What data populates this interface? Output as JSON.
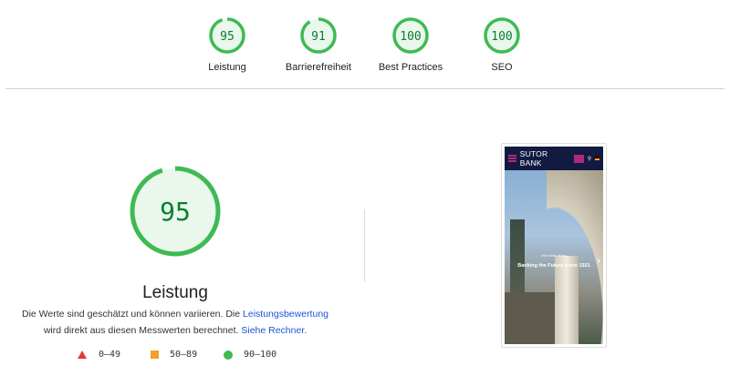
{
  "categories": [
    {
      "label": "Leistung",
      "score": 95
    },
    {
      "label": "Barrierefreiheit",
      "score": 91
    },
    {
      "label": "Best Practices",
      "score": 100
    },
    {
      "label": "SEO",
      "score": 100
    }
  ],
  "main": {
    "score": 95,
    "title": "Leistung",
    "desc_prefix": "Die Werte sind geschätzt und können variieren. Die ",
    "link1": "Leistungsbewertung",
    "desc_mid": " wird direkt aus diesen Messwerten berechnet. ",
    "link2": "Siehe Rechner."
  },
  "legend": {
    "fail": "0–49",
    "average": "50–89",
    "pass": "90–100"
  },
  "screenshot": {
    "brand": "SUTOR BANK",
    "kicker": "Ihre Sutor Bank",
    "headline": "Banking the Future since 1921"
  },
  "colors": {
    "pass": "#0cce6b",
    "pass_text": "#0a7e2e",
    "average": "#f2a12c",
    "fail": "#e53935",
    "link": "#1a56d6"
  }
}
